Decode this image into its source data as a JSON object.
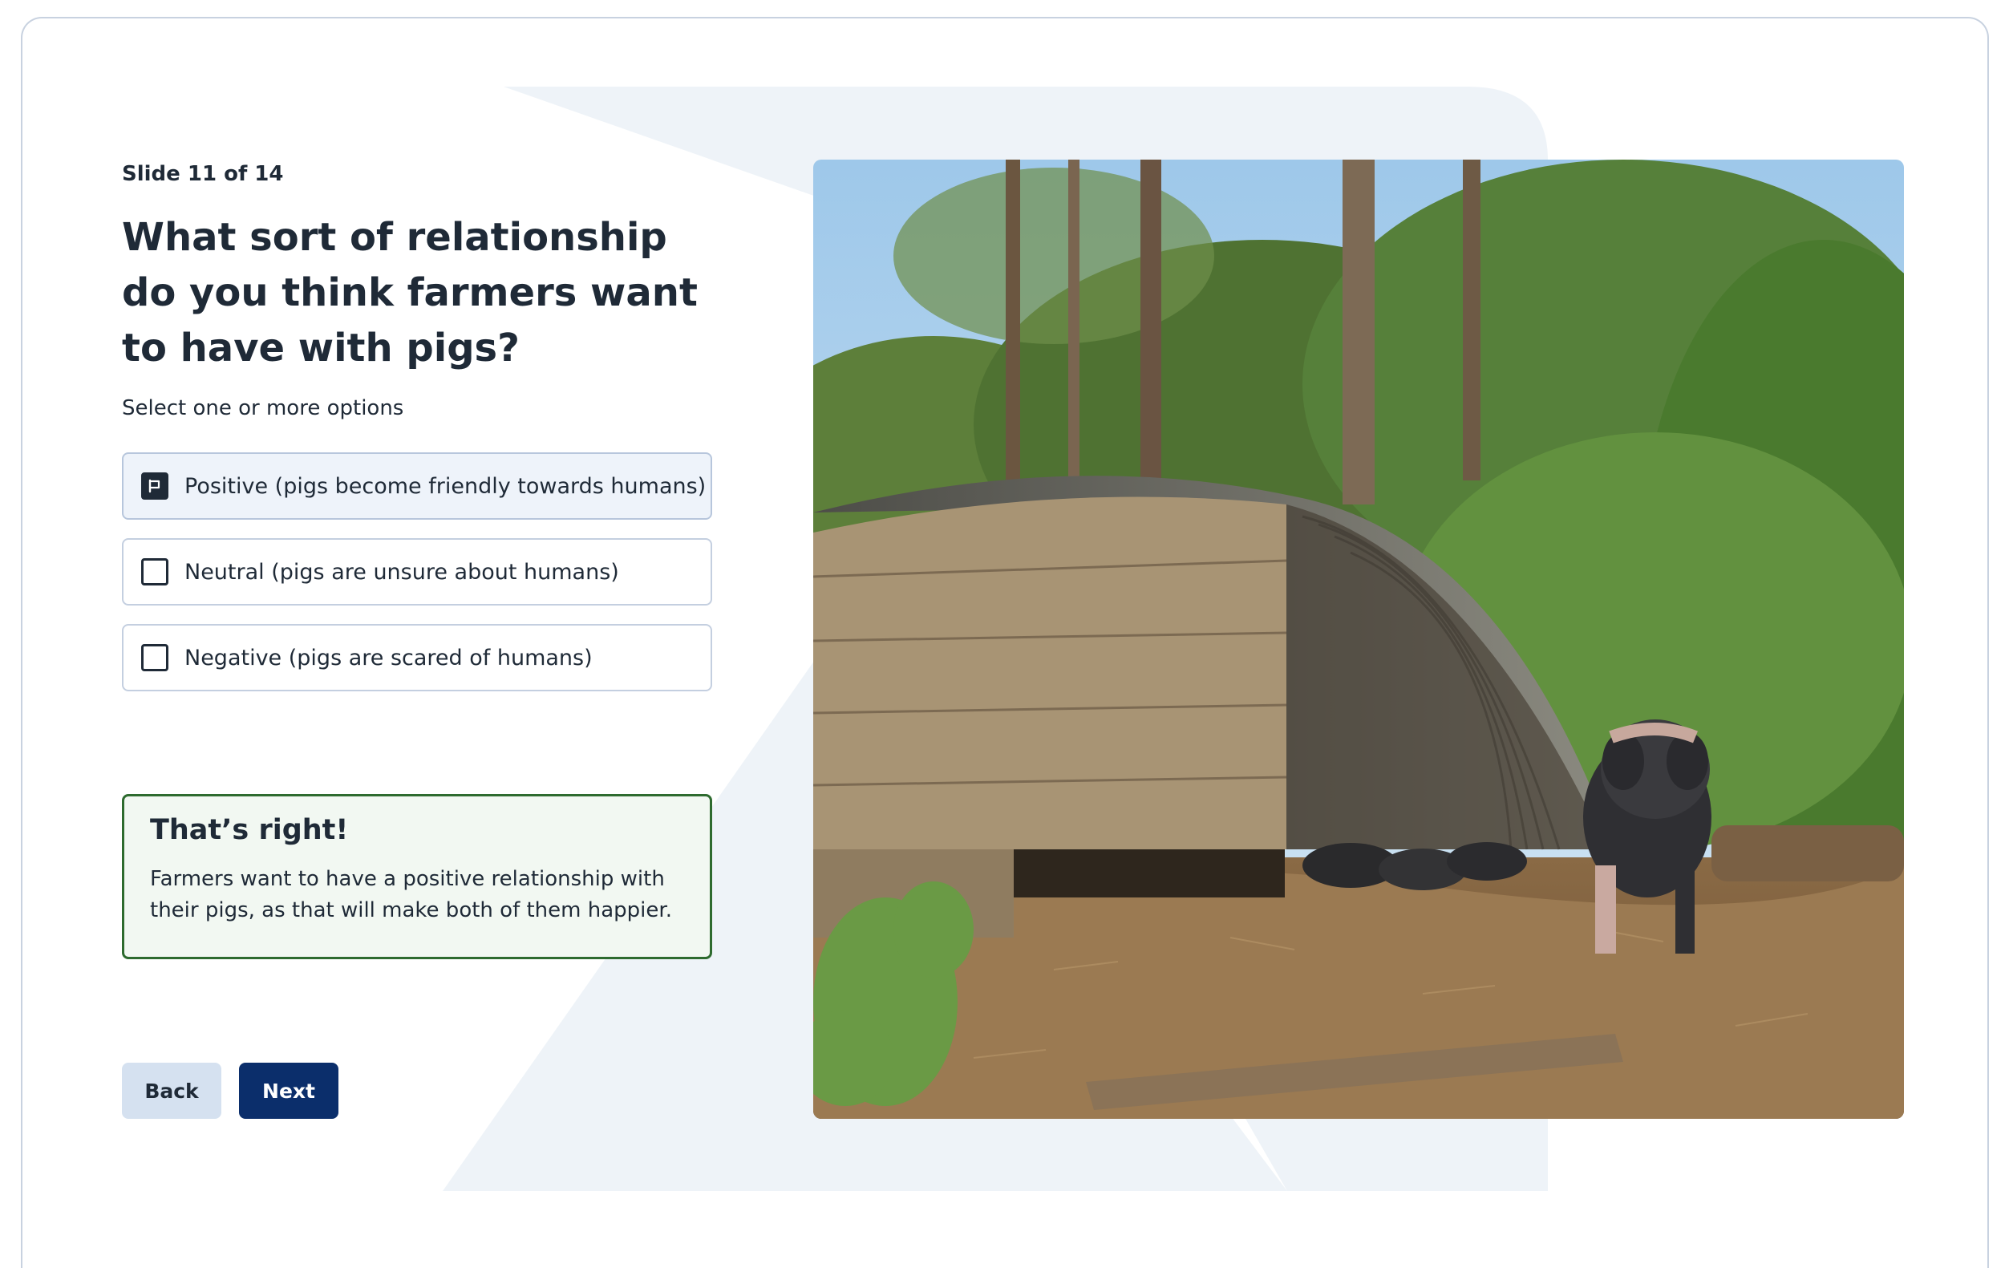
{
  "slide": {
    "counter": "Slide 11 of 14",
    "question": "What sort of relationship do you think farmers want to have with pigs?",
    "instruction": "Select one or more options"
  },
  "options": [
    {
      "label": "Positive (pigs become friendly towards humans)",
      "checked": true
    },
    {
      "label": "Neutral (pigs are unsure about humans)",
      "checked": false
    },
    {
      "label": "Negative (pigs are scared of humans)",
      "checked": false
    }
  ],
  "feedback": {
    "title": "That’s right!",
    "body": "Farmers want to have a positive relationship with their pigs, as that will make both of them happier."
  },
  "buttons": {
    "back": "Back",
    "next": "Next"
  },
  "image": {
    "subject": "pig-ark-with-pigs-photo"
  },
  "colors": {
    "primary": "#0b2e6b",
    "secondary": "#d5e1f0",
    "success_border": "#2e6b2f",
    "success_bg": "#f2f8f2",
    "text": "#1f2a37"
  }
}
